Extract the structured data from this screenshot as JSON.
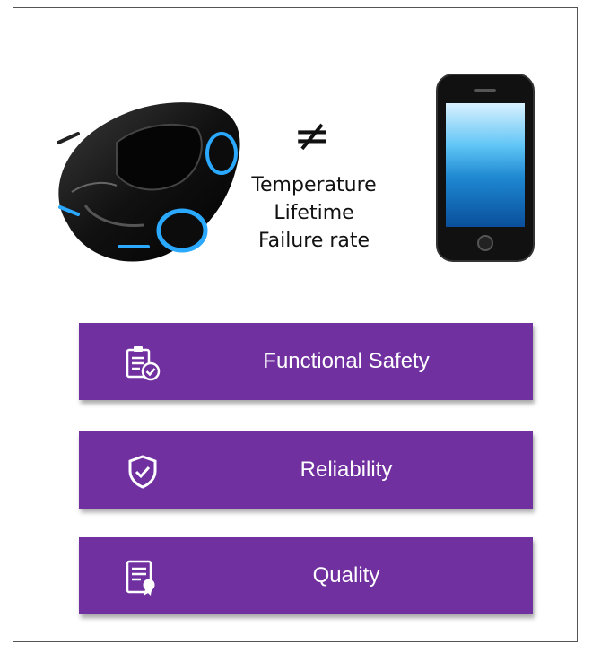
{
  "comparison": {
    "operator": "≠",
    "factors": [
      "Temperature",
      "Lifetime",
      "Failure rate"
    ]
  },
  "pillars": [
    {
      "label": "Functional Safety",
      "icon": "clipboard-check-icon"
    },
    {
      "label": "Reliability",
      "icon": "shield-check-icon"
    },
    {
      "label": "Quality",
      "icon": "certificate-icon"
    }
  ],
  "colors": {
    "pillar_background": "#7030a0",
    "pillar_text": "#ffffff",
    "accent_blue": "#2aa9ff"
  }
}
